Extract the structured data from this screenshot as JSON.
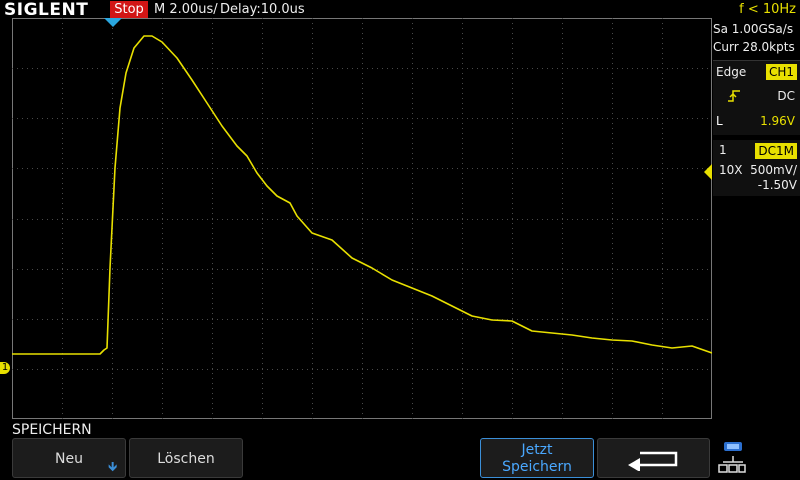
{
  "header": {
    "brand": "SIGLENT",
    "run_state": "Stop",
    "timebase": "M 2.00us/",
    "delay": "Delay:10.0us",
    "trigger_freq": "f < 10Hz"
  },
  "acquisition": {
    "sample_rate": "Sa 1.00GSa/s",
    "memory_depth": "Curr 28.0kpts"
  },
  "trigger": {
    "type": "Edge",
    "source": "CH1",
    "coupling": "DC",
    "level_label": "L",
    "level": "1.96V"
  },
  "channel1": {
    "number": "1",
    "coupling_impedance": "DC1M",
    "probe": "10X",
    "scale": "500mV/",
    "offset": "-1.50V",
    "ground_marker": "1"
  },
  "menu": {
    "title": "SPEICHERN",
    "keys": [
      {
        "label": "Neu"
      },
      {
        "label": "Löschen"
      },
      {
        "label": "Jetzt Speichern"
      }
    ]
  },
  "colors": {
    "trace": "#e8e000",
    "stop": "#d21515",
    "accent": "#3b8fd8",
    "grid": "#555555"
  }
}
